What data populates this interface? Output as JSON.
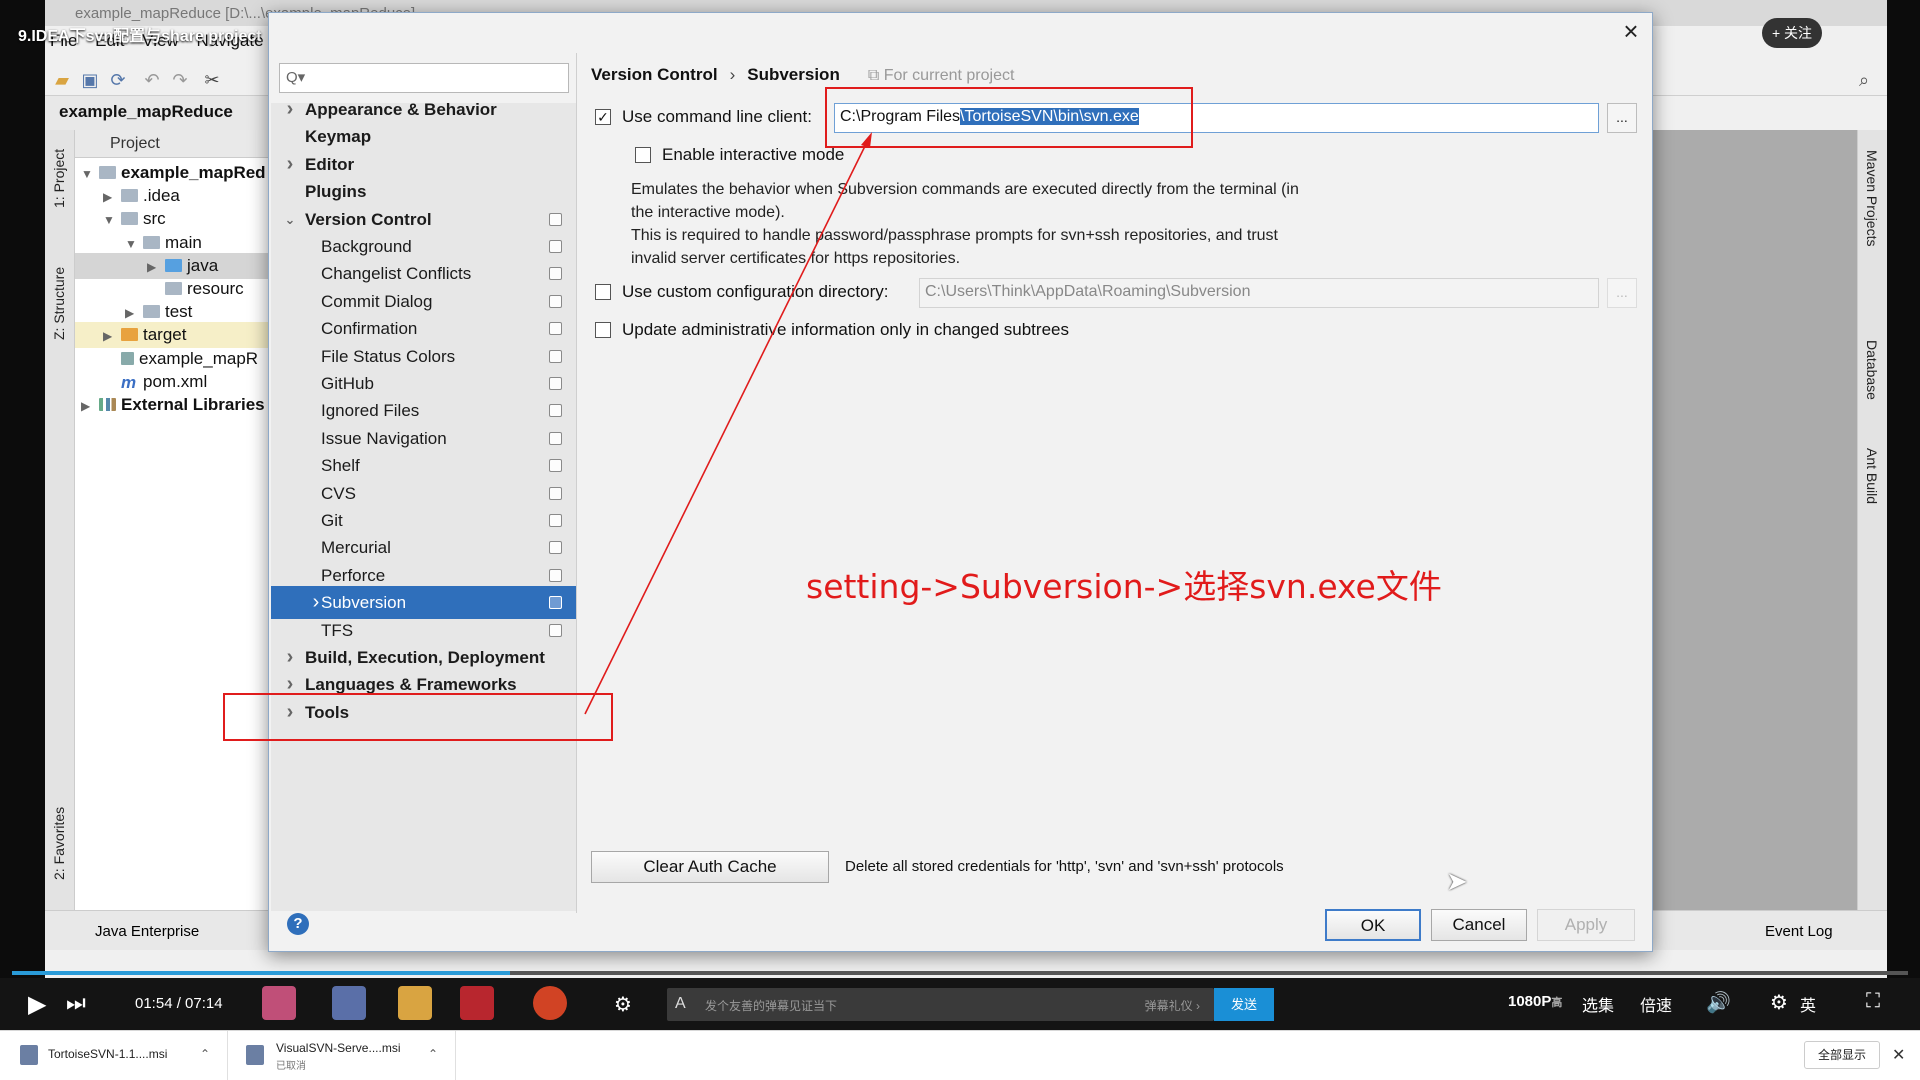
{
  "video": {
    "title": "9.IDEA下svn配置与share project【SSM整合实战】",
    "follow_label": "+ 关注"
  },
  "ide": {
    "window_title": "example_mapReduce [D:\\...\\example_mapReduce]",
    "menu": [
      "File",
      "Edit",
      "View",
      "Navigate"
    ],
    "nav_project": "example_mapReduce",
    "left_tabs": [
      "1: Project",
      "Z: Structure",
      "2: Favorites"
    ],
    "right_tabs": [
      "Maven Projects",
      "Database",
      "Ant Build"
    ],
    "project_header": "Project",
    "tree": [
      {
        "label": "example_mapRed",
        "icon": "module",
        "level": 0,
        "arrow": "down"
      },
      {
        "label": ".idea",
        "icon": "folder",
        "level": 1,
        "arrow": "right"
      },
      {
        "label": "src",
        "icon": "folder",
        "level": 1,
        "arrow": "down"
      },
      {
        "label": "main",
        "icon": "folder",
        "level": 2,
        "arrow": "down"
      },
      {
        "label": "java",
        "icon": "folder-blue",
        "level": 3,
        "arrow": "right"
      },
      {
        "label": "resourc",
        "icon": "folder",
        "level": 3,
        "arrow": ""
      },
      {
        "label": "test",
        "icon": "folder",
        "level": 2,
        "arrow": "right"
      },
      {
        "label": "target",
        "icon": "folder-orange",
        "level": 1,
        "arrow": "right"
      },
      {
        "label": "example_mapR",
        "icon": "file",
        "level": 1,
        "arrow": ""
      },
      {
        "label": "pom.xml",
        "icon": "maven",
        "level": 1,
        "arrow": ""
      },
      {
        "label": "External Libraries",
        "icon": "library",
        "level": 0,
        "arrow": "right"
      }
    ],
    "bottom_tabs": {
      "java_enterprise": "Java Enterprise",
      "event_log": "Event Log"
    }
  },
  "dialog": {
    "search_placeholder": "Q▾",
    "settings_tree": [
      {
        "label": "Appearance & Behavior",
        "bold": true,
        "arrow": "right",
        "indent": 0,
        "project": false
      },
      {
        "label": "Keymap",
        "bold": true,
        "arrow": "",
        "indent": 0,
        "project": false
      },
      {
        "label": "Editor",
        "bold": true,
        "arrow": "right",
        "indent": 0,
        "project": false
      },
      {
        "label": "Plugins",
        "bold": true,
        "arrow": "",
        "indent": 0,
        "project": false
      },
      {
        "label": "Version Control",
        "bold": true,
        "arrow": "down",
        "indent": 0,
        "project": true
      },
      {
        "label": "Background",
        "bold": false,
        "arrow": "",
        "indent": 1,
        "project": true
      },
      {
        "label": "Changelist Conflicts",
        "bold": false,
        "arrow": "",
        "indent": 1,
        "project": true
      },
      {
        "label": "Commit Dialog",
        "bold": false,
        "arrow": "",
        "indent": 1,
        "project": true
      },
      {
        "label": "Confirmation",
        "bold": false,
        "arrow": "",
        "indent": 1,
        "project": true
      },
      {
        "label": "File Status Colors",
        "bold": false,
        "arrow": "",
        "indent": 1,
        "project": true
      },
      {
        "label": "GitHub",
        "bold": false,
        "arrow": "",
        "indent": 1,
        "project": true
      },
      {
        "label": "Ignored Files",
        "bold": false,
        "arrow": "",
        "indent": 1,
        "project": true
      },
      {
        "label": "Issue Navigation",
        "bold": false,
        "arrow": "",
        "indent": 1,
        "project": true
      },
      {
        "label": "Shelf",
        "bold": false,
        "arrow": "",
        "indent": 1,
        "project": true
      },
      {
        "label": "CVS",
        "bold": false,
        "arrow": "",
        "indent": 1,
        "project": true
      },
      {
        "label": "Git",
        "bold": false,
        "arrow": "",
        "indent": 1,
        "project": true
      },
      {
        "label": "Mercurial",
        "bold": false,
        "arrow": "",
        "indent": 1,
        "project": true
      },
      {
        "label": "Perforce",
        "bold": false,
        "arrow": "",
        "indent": 1,
        "project": true
      },
      {
        "label": "Subversion",
        "bold": false,
        "arrow": "right",
        "indent": 1,
        "project": true,
        "selected": true
      },
      {
        "label": "TFS",
        "bold": false,
        "arrow": "",
        "indent": 1,
        "project": true
      },
      {
        "label": "Build, Execution, Deployment",
        "bold": true,
        "arrow": "right",
        "indent": 0,
        "project": false
      },
      {
        "label": "Languages & Frameworks",
        "bold": true,
        "arrow": "right",
        "indent": 0,
        "project": false
      },
      {
        "label": "Tools",
        "bold": true,
        "arrow": "right",
        "indent": 0,
        "project": false
      }
    ],
    "breadcrumb": {
      "parent": "Version Control",
      "sep": "›",
      "current": "Subversion",
      "scope": "For current project"
    },
    "use_cmd_client": {
      "label": "Use command line client:",
      "checked": true,
      "value_plain": "C:\\Program Files",
      "value_selected": "\\TortoiseSVN\\bin\\svn.exe",
      "browse": "..."
    },
    "interactive_mode": {
      "label": "Enable interactive mode",
      "checked": false
    },
    "description": [
      "Emulates the behavior when Subversion commands are executed directly from the terminal (in",
      "the interactive mode).",
      "This is required to handle password/passphrase prompts for svn+ssh repositories, and trust",
      "invalid server certificates for https repositories."
    ],
    "custom_config": {
      "label": "Use custom configuration directory:",
      "checked": false,
      "value": "C:\\Users\\Think\\AppData\\Roaming\\Subversion",
      "browse": "..."
    },
    "update_admin": {
      "label": "Update administrative information only in changed subtrees",
      "checked": false
    },
    "clear_auth_cache": {
      "label": "Clear Auth Cache",
      "desc": "Delete all stored credentials for 'http', 'svn' and 'svn+ssh' protocols"
    },
    "buttons": {
      "ok": "OK",
      "cancel": "Cancel",
      "apply": "Apply",
      "help": "?"
    }
  },
  "annotation": "setting->Subversion->选择svn.exe文件",
  "player": {
    "time": "01:54 / 07:14",
    "progress": 0.2626,
    "danmu_placeholder": "发个友善的弹幕见证当下",
    "danmu_etiquette": "弹幕礼仪 ›",
    "send": "发送",
    "quality": "1080P",
    "quality_suffix": "高",
    "episodes": "选集",
    "speed": "倍速",
    "ime": "英"
  },
  "downloads": [
    {
      "name": "TortoiseSVN-1.1....msi",
      "status": ""
    },
    {
      "name": "VisualSVN-Serve....msi",
      "status": "已取消"
    }
  ],
  "download_bar": {
    "show_all": "全部显示",
    "close": "✕"
  },
  "colors": {
    "selection": "#2f6fbb",
    "annotation": "#e11b1b",
    "progress": "#2a9bd8",
    "send": "#1a8fd6"
  }
}
